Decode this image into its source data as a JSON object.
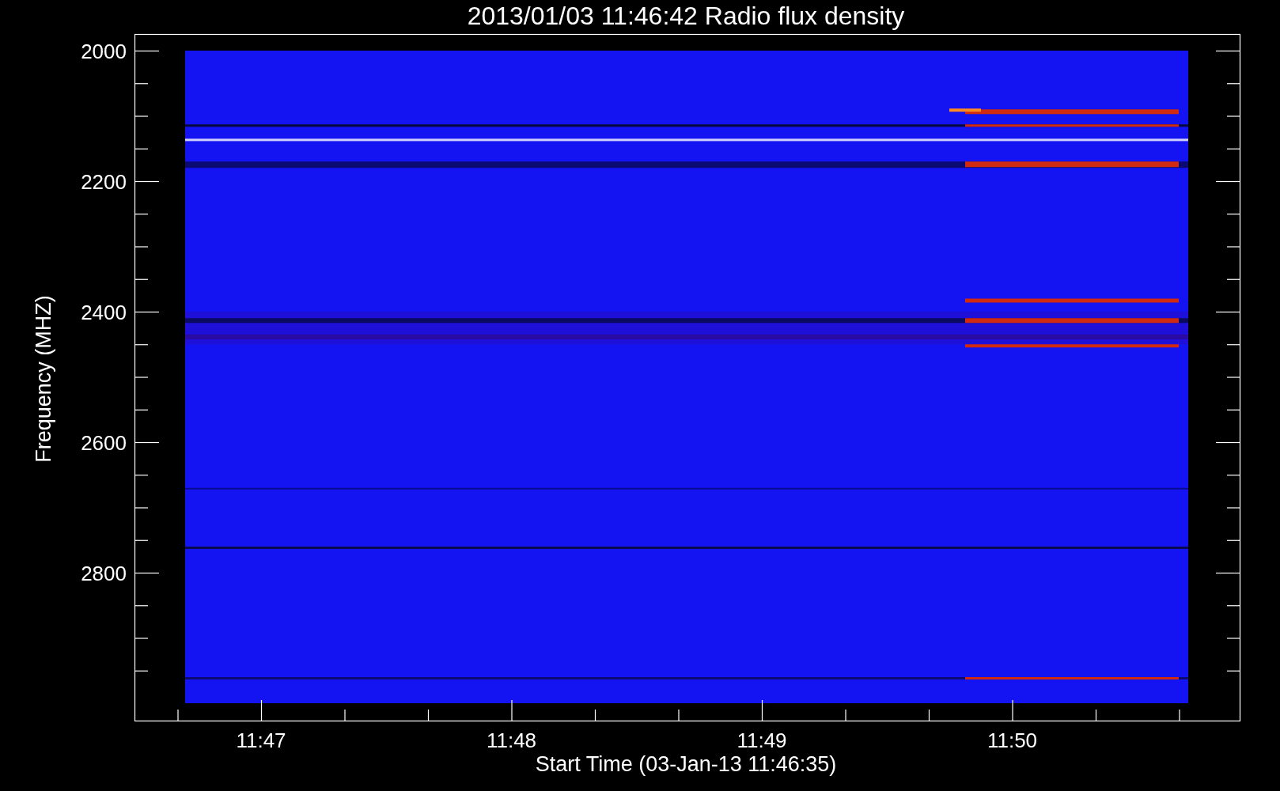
{
  "title": "2013/01/03 11:46:42 Radio flux density",
  "y_axis": {
    "label": "Frequency (MHZ)",
    "tick_labels": [
      "2000",
      "2200",
      "2400",
      "2600",
      "2800"
    ]
  },
  "x_axis": {
    "label": "Start Time (03-Jan-13 11:46:35)",
    "tick_labels": [
      "11:47",
      "11:48",
      "11:49",
      "11:50"
    ]
  }
}
